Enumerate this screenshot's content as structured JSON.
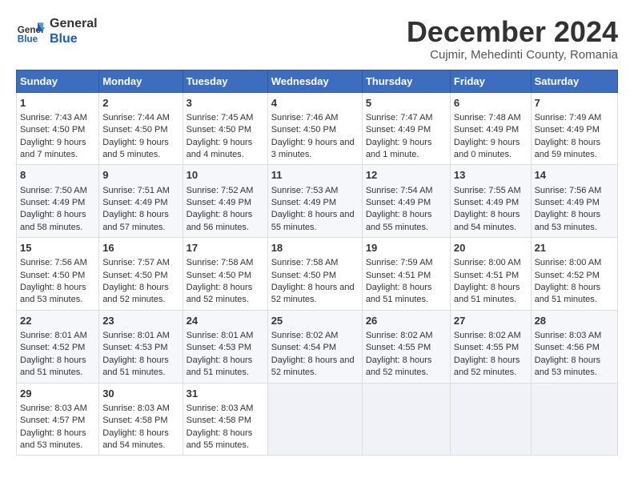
{
  "logo": {
    "line1": "General",
    "line2": "Blue"
  },
  "title": "December 2024",
  "subtitle": "Cujmir, Mehedinti County, Romania",
  "days_of_week": [
    "Sunday",
    "Monday",
    "Tuesday",
    "Wednesday",
    "Thursday",
    "Friday",
    "Saturday"
  ],
  "weeks": [
    [
      {
        "day": "1",
        "sunrise": "7:43 AM",
        "sunset": "4:50 PM",
        "daylight": "9 hours and 7 minutes."
      },
      {
        "day": "2",
        "sunrise": "7:44 AM",
        "sunset": "4:50 PM",
        "daylight": "9 hours and 5 minutes."
      },
      {
        "day": "3",
        "sunrise": "7:45 AM",
        "sunset": "4:50 PM",
        "daylight": "9 hours and 4 minutes."
      },
      {
        "day": "4",
        "sunrise": "7:46 AM",
        "sunset": "4:50 PM",
        "daylight": "9 hours and 3 minutes."
      },
      {
        "day": "5",
        "sunrise": "7:47 AM",
        "sunset": "4:49 PM",
        "daylight": "9 hours and 1 minute."
      },
      {
        "day": "6",
        "sunrise": "7:48 AM",
        "sunset": "4:49 PM",
        "daylight": "9 hours and 0 minutes."
      },
      {
        "day": "7",
        "sunrise": "7:49 AM",
        "sunset": "4:49 PM",
        "daylight": "8 hours and 59 minutes."
      }
    ],
    [
      {
        "day": "8",
        "sunrise": "7:50 AM",
        "sunset": "4:49 PM",
        "daylight": "8 hours and 58 minutes."
      },
      {
        "day": "9",
        "sunrise": "7:51 AM",
        "sunset": "4:49 PM",
        "daylight": "8 hours and 57 minutes."
      },
      {
        "day": "10",
        "sunrise": "7:52 AM",
        "sunset": "4:49 PM",
        "daylight": "8 hours and 56 minutes."
      },
      {
        "day": "11",
        "sunrise": "7:53 AM",
        "sunset": "4:49 PM",
        "daylight": "8 hours and 55 minutes."
      },
      {
        "day": "12",
        "sunrise": "7:54 AM",
        "sunset": "4:49 PM",
        "daylight": "8 hours and 55 minutes."
      },
      {
        "day": "13",
        "sunrise": "7:55 AM",
        "sunset": "4:49 PM",
        "daylight": "8 hours and 54 minutes."
      },
      {
        "day": "14",
        "sunrise": "7:56 AM",
        "sunset": "4:49 PM",
        "daylight": "8 hours and 53 minutes."
      }
    ],
    [
      {
        "day": "15",
        "sunrise": "7:56 AM",
        "sunset": "4:50 PM",
        "daylight": "8 hours and 53 minutes."
      },
      {
        "day": "16",
        "sunrise": "7:57 AM",
        "sunset": "4:50 PM",
        "daylight": "8 hours and 52 minutes."
      },
      {
        "day": "17",
        "sunrise": "7:58 AM",
        "sunset": "4:50 PM",
        "daylight": "8 hours and 52 minutes."
      },
      {
        "day": "18",
        "sunrise": "7:58 AM",
        "sunset": "4:50 PM",
        "daylight": "8 hours and 52 minutes."
      },
      {
        "day": "19",
        "sunrise": "7:59 AM",
        "sunset": "4:51 PM",
        "daylight": "8 hours and 51 minutes."
      },
      {
        "day": "20",
        "sunrise": "8:00 AM",
        "sunset": "4:51 PM",
        "daylight": "8 hours and 51 minutes."
      },
      {
        "day": "21",
        "sunrise": "8:00 AM",
        "sunset": "4:52 PM",
        "daylight": "8 hours and 51 minutes."
      }
    ],
    [
      {
        "day": "22",
        "sunrise": "8:01 AM",
        "sunset": "4:52 PM",
        "daylight": "8 hours and 51 minutes."
      },
      {
        "day": "23",
        "sunrise": "8:01 AM",
        "sunset": "4:53 PM",
        "daylight": "8 hours and 51 minutes."
      },
      {
        "day": "24",
        "sunrise": "8:01 AM",
        "sunset": "4:53 PM",
        "daylight": "8 hours and 51 minutes."
      },
      {
        "day": "25",
        "sunrise": "8:02 AM",
        "sunset": "4:54 PM",
        "daylight": "8 hours and 52 minutes."
      },
      {
        "day": "26",
        "sunrise": "8:02 AM",
        "sunset": "4:55 PM",
        "daylight": "8 hours and 52 minutes."
      },
      {
        "day": "27",
        "sunrise": "8:02 AM",
        "sunset": "4:55 PM",
        "daylight": "8 hours and 52 minutes."
      },
      {
        "day": "28",
        "sunrise": "8:03 AM",
        "sunset": "4:56 PM",
        "daylight": "8 hours and 53 minutes."
      }
    ],
    [
      {
        "day": "29",
        "sunrise": "8:03 AM",
        "sunset": "4:57 PM",
        "daylight": "8 hours and 53 minutes."
      },
      {
        "day": "30",
        "sunrise": "8:03 AM",
        "sunset": "4:58 PM",
        "daylight": "8 hours and 54 minutes."
      },
      {
        "day": "31",
        "sunrise": "8:03 AM",
        "sunset": "4:58 PM",
        "daylight": "8 hours and 55 minutes."
      },
      null,
      null,
      null,
      null
    ]
  ]
}
